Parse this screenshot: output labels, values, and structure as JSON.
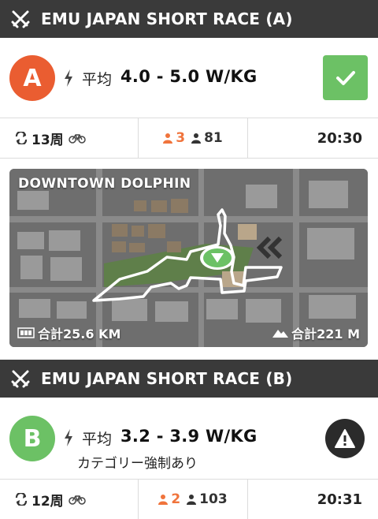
{
  "colors": {
    "header_bg": "#3a3a3a",
    "cat_a": "#ea5d31",
    "cat_b": "#6cc165",
    "joined_green": "#6cc165",
    "signup_orange": "#f0743c"
  },
  "event_a": {
    "title": "EMU JAPAN SHORT RACE (A)",
    "header_icon": "crossed-swords-icon",
    "category": "A",
    "avg_label": "平均",
    "wkg": "4.0 - 5.0 W/KG",
    "status_icon": "check-icon",
    "laps": "13周",
    "signed_up_count": "3",
    "riders_count": "81",
    "start_time": "20:30"
  },
  "map": {
    "route_name": "DOWNTOWN DOLPHIN",
    "distance": "合計25.6 KM",
    "elevation": "合計221 M"
  },
  "event_b": {
    "title": "EMU JAPAN SHORT RACE (B)",
    "header_icon": "crossed-swords-icon",
    "category": "B",
    "avg_label": "平均",
    "wkg": "3.2 - 3.9 W/KG",
    "forced_category": "カテゴリー強制あり",
    "status_icon": "warning-icon",
    "laps": "12周",
    "signed_up_count": "2",
    "riders_count": "103",
    "start_time": "20:31"
  }
}
